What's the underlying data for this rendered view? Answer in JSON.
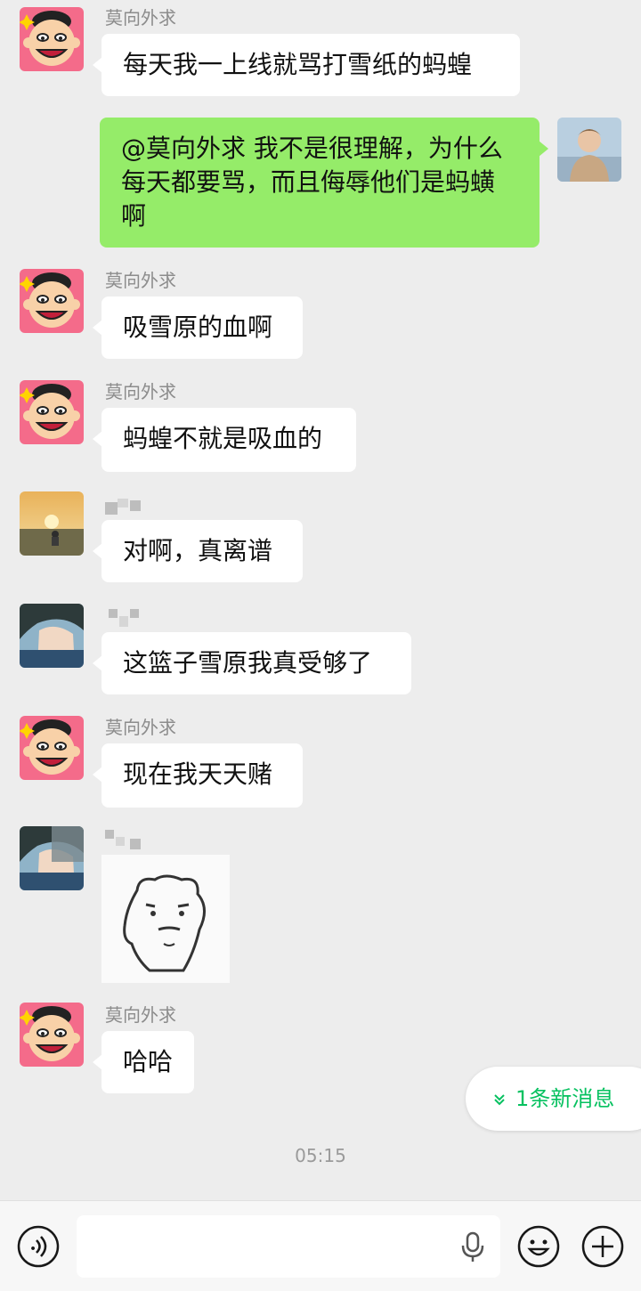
{
  "messages": [
    {
      "sender": "莫向外求",
      "text": "每天我一上线就骂打雪纸的蚂蝗"
    },
    {
      "sender": "",
      "text": "@莫向外求  我不是很理解，为什么每天都要骂，而且侮辱他们是蚂蟥啊"
    },
    {
      "sender": "莫向外求",
      "text": "吸雪原的血啊"
    },
    {
      "sender": "莫向外求",
      "text": "蚂蝗不就是吸血的"
    },
    {
      "sender": "",
      "text": "对啊，真离谱"
    },
    {
      "sender": "",
      "text": "这篮子雪原我真受够了"
    },
    {
      "sender": "莫向外求",
      "text": "现在我天天赌"
    },
    {
      "sender": "",
      "text": ""
    },
    {
      "sender": "莫向外求",
      "text": "哈哈"
    }
  ],
  "new_messages_label": "1条新消息",
  "timestamp": "05:15",
  "colors": {
    "my_bubble": "#95ec69",
    "their_bubble": "#ffffff",
    "accent": "#07c160",
    "background": "#ededed"
  },
  "icons": {
    "voice": "voice-toggle-icon",
    "mic": "microphone-icon",
    "emoji": "emoji-icon",
    "plus": "plus-icon",
    "chevron": "double-chevron-down-icon"
  }
}
